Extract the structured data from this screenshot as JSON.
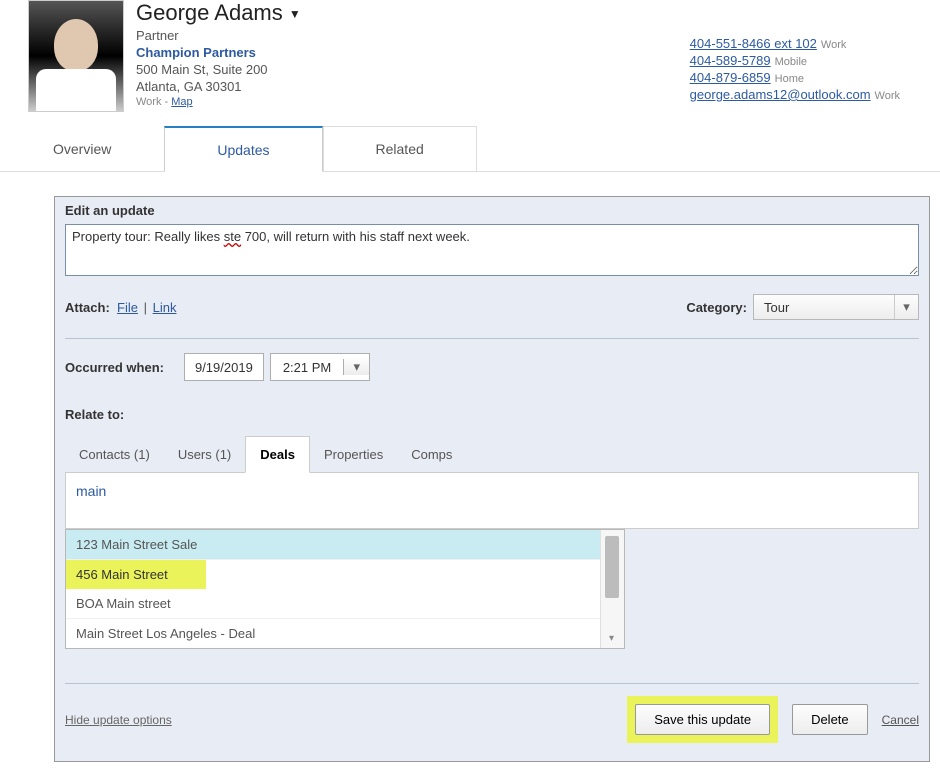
{
  "contact": {
    "name": "George Adams",
    "role": "Partner",
    "company": "Champion Partners",
    "addr1": "500 Main St, Suite 200",
    "addr2": "Atlanta, GA 30301",
    "map_prefix": "Work - ",
    "map_link": "Map",
    "phones": [
      {
        "value": "404-551-8466 ext 102",
        "tag": "Work"
      },
      {
        "value": "404-589-5789",
        "tag": "Mobile"
      },
      {
        "value": "404-879-6859",
        "tag": "Home"
      }
    ],
    "email": {
      "value": "george.adams12@outlook.com",
      "tag": "Work"
    }
  },
  "tabs": {
    "overview": "Overview",
    "updates": "Updates",
    "related": "Related"
  },
  "panel": {
    "title": "Edit an update",
    "note_pre": "Property tour: Really likes ",
    "note_err": "ste",
    "note_post": " 700, will return with his staff next week.",
    "attach_label": "Attach:",
    "file_link": "File",
    "link_link": "Link",
    "category_label": "Category:",
    "category_value": "Tour",
    "occurred_label": "Occurred when:",
    "date_value": "9/19/2019",
    "time_value": "2:21 PM",
    "relate_label": "Relate to:",
    "rel_tabs": {
      "contacts": "Contacts (1)",
      "users": "Users (1)",
      "deals": "Deals",
      "properties": "Properties",
      "comps": "Comps"
    },
    "search_value": "main",
    "results": [
      "123 Main Street Sale",
      "456 Main Street",
      "BOA Main street",
      "Main Street Los Angeles - Deal"
    ],
    "hide_options": "Hide update options",
    "save_label": "Save this update",
    "delete_label": "Delete",
    "cancel_label": "Cancel"
  }
}
